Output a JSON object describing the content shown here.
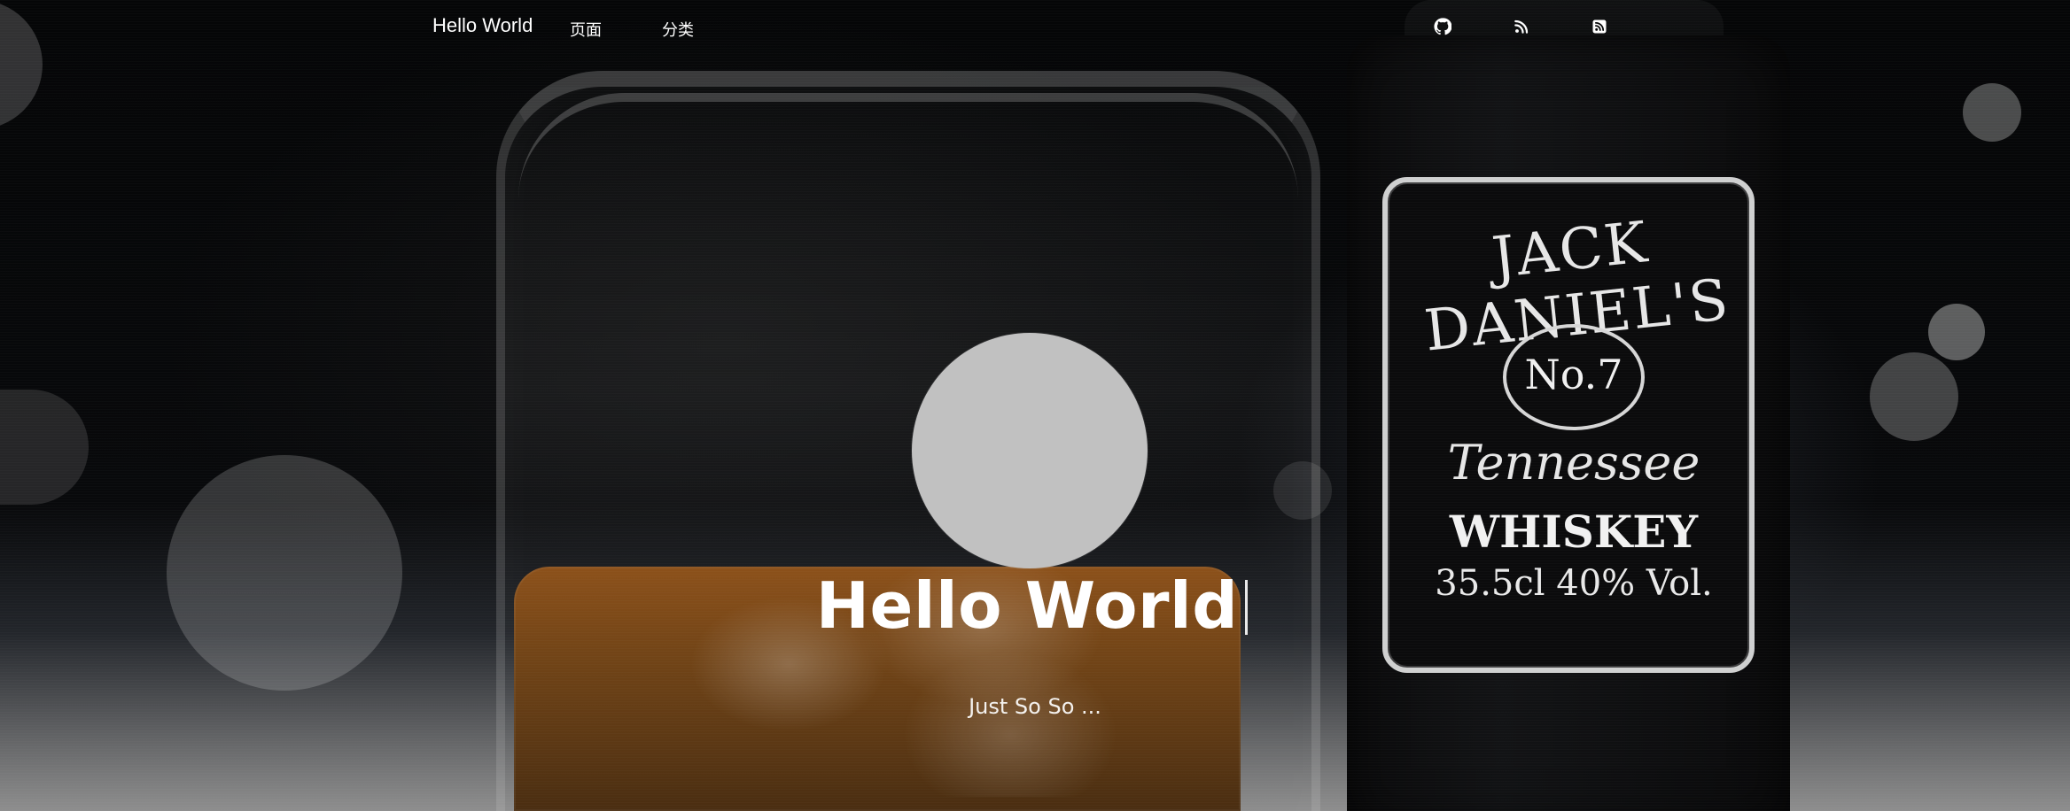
{
  "nav": {
    "brand": "Hello World",
    "items": [
      {
        "label": "页面"
      },
      {
        "label": "分类"
      }
    ],
    "icons": [
      "github-icon",
      "rss-icon",
      "rss-square-icon"
    ]
  },
  "hero": {
    "title": "Hello World",
    "subtitle": "Just So So ..."
  },
  "background_labels": {
    "bottle_brand": "JACK DANIEL'S",
    "bottle_no": "No.7",
    "bottle_line1": "Tennessee",
    "bottle_line2": "WHISKEY",
    "bottle_line3": "35.5cl 40% Vol."
  },
  "colors": {
    "bg": "#050607",
    "text": "#ffffff",
    "avatar": "#c1c1c1"
  }
}
